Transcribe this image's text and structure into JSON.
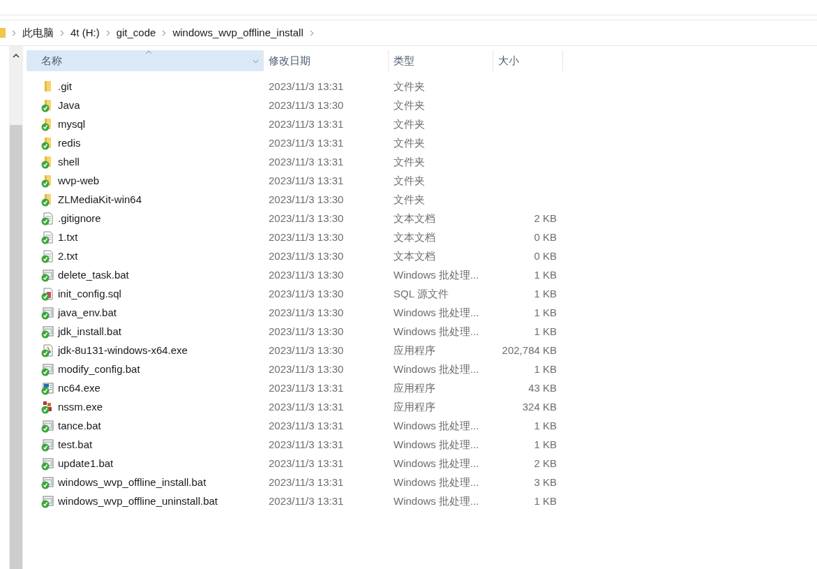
{
  "breadcrumb": [
    "此电脑",
    "4t (H:)",
    "git_code",
    "windows_wvp_offline_install"
  ],
  "columns": [
    {
      "label": "名称",
      "sorted": true
    },
    {
      "label": "修改日期",
      "sorted": false
    },
    {
      "label": "类型",
      "sorted": false
    },
    {
      "label": "大小",
      "sorted": false
    }
  ],
  "files": [
    {
      "name": ".git",
      "date": "2023/11/3 13:31",
      "type": "文件夹",
      "kind": "folder",
      "synced": false
    },
    {
      "name": "Java",
      "date": "2023/11/3 13:30",
      "type": "文件夹",
      "kind": "folder",
      "synced": true
    },
    {
      "name": "mysql",
      "date": "2023/11/3 13:31",
      "type": "文件夹",
      "kind": "folder",
      "synced": true
    },
    {
      "name": "redis",
      "date": "2023/11/3 13:31",
      "type": "文件夹",
      "kind": "folder",
      "synced": true
    },
    {
      "name": "shell",
      "date": "2023/11/3 13:31",
      "type": "文件夹",
      "kind": "folder",
      "synced": true
    },
    {
      "name": "wvp-web",
      "date": "2023/11/3 13:31",
      "type": "文件夹",
      "kind": "folder",
      "synced": true
    },
    {
      "name": "ZLMediaKit-win64",
      "date": "2023/11/3 13:30",
      "type": "文件夹",
      "kind": "folder",
      "synced": true
    },
    {
      "name": ".gitignore",
      "date": "2023/11/3 13:30",
      "type": "文本文档",
      "size": "2 KB",
      "kind": "text",
      "synced": true
    },
    {
      "name": "1.txt",
      "date": "2023/11/3 13:30",
      "type": "文本文档",
      "size": "0 KB",
      "kind": "text",
      "synced": true
    },
    {
      "name": "2.txt",
      "date": "2023/11/3 13:30",
      "type": "文本文档",
      "size": "0 KB",
      "kind": "text",
      "synced": true
    },
    {
      "name": "delete_task.bat",
      "date": "2023/11/3 13:30",
      "type": "Windows 批处理...",
      "size": "1 KB",
      "kind": "batch",
      "synced": true
    },
    {
      "name": "init_config.sql",
      "date": "2023/11/3 13:30",
      "type": "SQL 源文件",
      "size": "1 KB",
      "kind": "sql",
      "synced": true
    },
    {
      "name": "java_env.bat",
      "date": "2023/11/3 13:30",
      "type": "Windows 批处理...",
      "size": "1 KB",
      "kind": "batch",
      "synced": true
    },
    {
      "name": "jdk_install.bat",
      "date": "2023/11/3 13:30",
      "type": "Windows 批处理...",
      "size": "1 KB",
      "kind": "batch",
      "synced": true
    },
    {
      "name": "jdk-8u131-windows-x64.exe",
      "date": "2023/11/3 13:30",
      "type": "应用程序",
      "size": "202,784 KB",
      "kind": "installer",
      "synced": true
    },
    {
      "name": "modify_config.bat",
      "date": "2023/11/3 13:30",
      "type": "Windows 批处理...",
      "size": "1 KB",
      "kind": "batch",
      "synced": true
    },
    {
      "name": "nc64.exe",
      "date": "2023/11/3 13:31",
      "type": "应用程序",
      "size": "43 KB",
      "kind": "app",
      "synced": true
    },
    {
      "name": "nssm.exe",
      "date": "2023/11/3 13:31",
      "type": "应用程序",
      "size": "324 KB",
      "kind": "service",
      "synced": true
    },
    {
      "name": "tance.bat",
      "date": "2023/11/3 13:31",
      "type": "Windows 批处理...",
      "size": "1 KB",
      "kind": "batch",
      "synced": true
    },
    {
      "name": "test.bat",
      "date": "2023/11/3 13:31",
      "type": "Windows 批处理...",
      "size": "1 KB",
      "kind": "batch",
      "synced": true
    },
    {
      "name": "update1.bat",
      "date": "2023/11/3 13:31",
      "type": "Windows 批处理...",
      "size": "2 KB",
      "kind": "batch",
      "synced": true
    },
    {
      "name": "windows_wvp_offline_install.bat",
      "date": "2023/11/3 13:31",
      "type": "Windows 批处理...",
      "size": "3 KB",
      "kind": "batch",
      "synced": true
    },
    {
      "name": "windows_wvp_offline_uninstall.bat",
      "date": "2023/11/3 13:31",
      "type": "Windows 批处理...",
      "size": "1 KB",
      "kind": "batch",
      "synced": true
    }
  ]
}
